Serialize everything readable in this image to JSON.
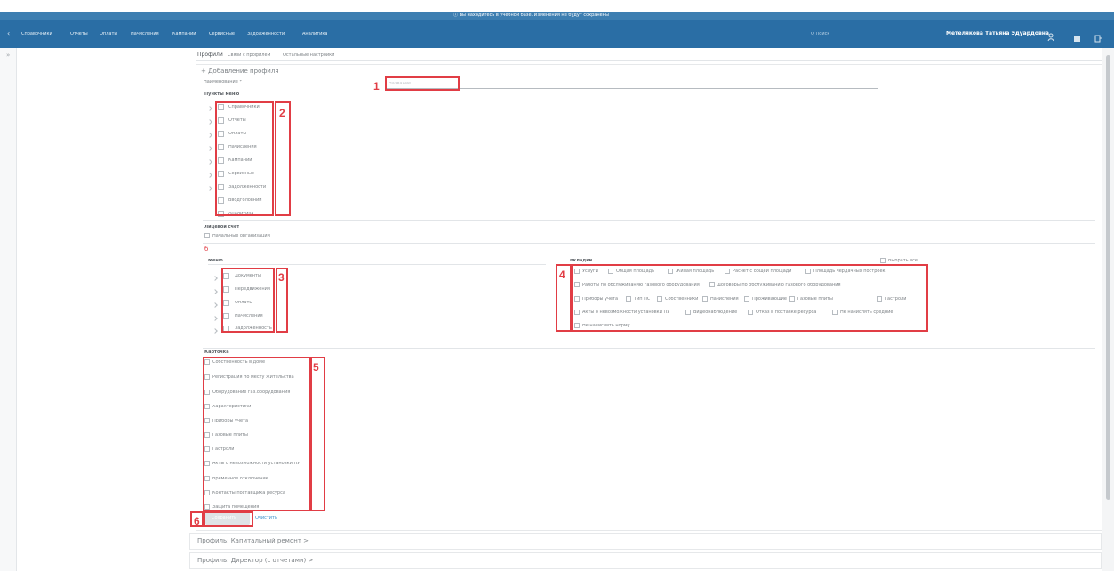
{
  "banner": {
    "text": "ⓘ Вы находитесь в учебной базе. Изменения не будут сохранены"
  },
  "menu": {
    "items": [
      "Справочники",
      "Отчеты",
      "Оплаты",
      "Начисления",
      "Кампании",
      "Сервисные",
      "Задолженности",
      "Аналитика"
    ],
    "search_placeholder": "Q Поиск",
    "user_name": "Метелякова Татьяна Эдуардовна"
  },
  "tabs": [
    "Профили",
    "Связи с профилем",
    "Остальные настройки"
  ],
  "profile": {
    "add_title": "+ Добавление профиля",
    "name_label": "Наименование *",
    "name_placeholder": "Название"
  },
  "menu_items_title": "Пункты меню",
  "menu_items": [
    "Справочники",
    "Отчеты",
    "Оплаты",
    "Начисления",
    "Кампании",
    "Сервисные",
    "Задолженности",
    "Вводголовний",
    "Аналитика"
  ],
  "import_title": "Лицевой счет",
  "import_option": "Начальные организации",
  "section_mark": "б",
  "marked_title": "Меню",
  "marked_items": [
    "Документы",
    "Передвижения",
    "Оплаты",
    "Начисления",
    "Задолженность"
  ],
  "tabs_title": "Вкладки",
  "select_all": "Выбрать все",
  "tabs_rows": [
    [
      "Услуги",
      "Общая площадь",
      "Жилая площадь",
      "Расчет с общей площади",
      "Площадь чердачных построек"
    ],
    [
      "Работы по обслуживанию газового оборудования",
      "Договоры по обслуживанию газового оборудования"
    ],
    [
      "Приборы учета",
      "Тип ПС",
      "Собственники",
      "Начисления",
      "Проживающие",
      "Газовые плиты",
      "Гастроли"
    ],
    [
      "Акты о невозможности установки ПУ",
      "Видеонаблюдение",
      "Отказ в поставке ресурса",
      "Не начислять средние"
    ],
    [
      "Не начислять норму"
    ]
  ],
  "cards_title": "Карточка",
  "cards_items": [
    "Собственность в доме",
    "Регистрация по месту жительства",
    "Оборудование газ.оборудования",
    "Характеристики",
    "Приборы учета",
    "Газовые плиты",
    "Гастроли",
    "Акты о невозможности установки ПУ",
    "Временное отключение",
    "Контакты поставщика ресурса",
    "Защита помещения"
  ],
  "buttons": {
    "save": "Сохранить",
    "clear": "Очистить"
  },
  "profiles_list": [
    "Профиль: Капитальный ремонт >",
    "Профиль: Директор (с отчетами) >"
  ],
  "marks": {
    "m1": "1",
    "m2": "2",
    "m3": "3",
    "m4": "4",
    "m5": "5",
    "m6": "6"
  },
  "colors": {
    "banner": "#3d7eb1",
    "menubar": "#2a6ea5",
    "red_annotation": "#e13d45",
    "link": "#3a8fcb"
  },
  "icons": [
    "info-icon",
    "back-arrow-icon",
    "search-icon",
    "users-icon",
    "building-icon",
    "logout-icon",
    "scrollbar"
  ]
}
